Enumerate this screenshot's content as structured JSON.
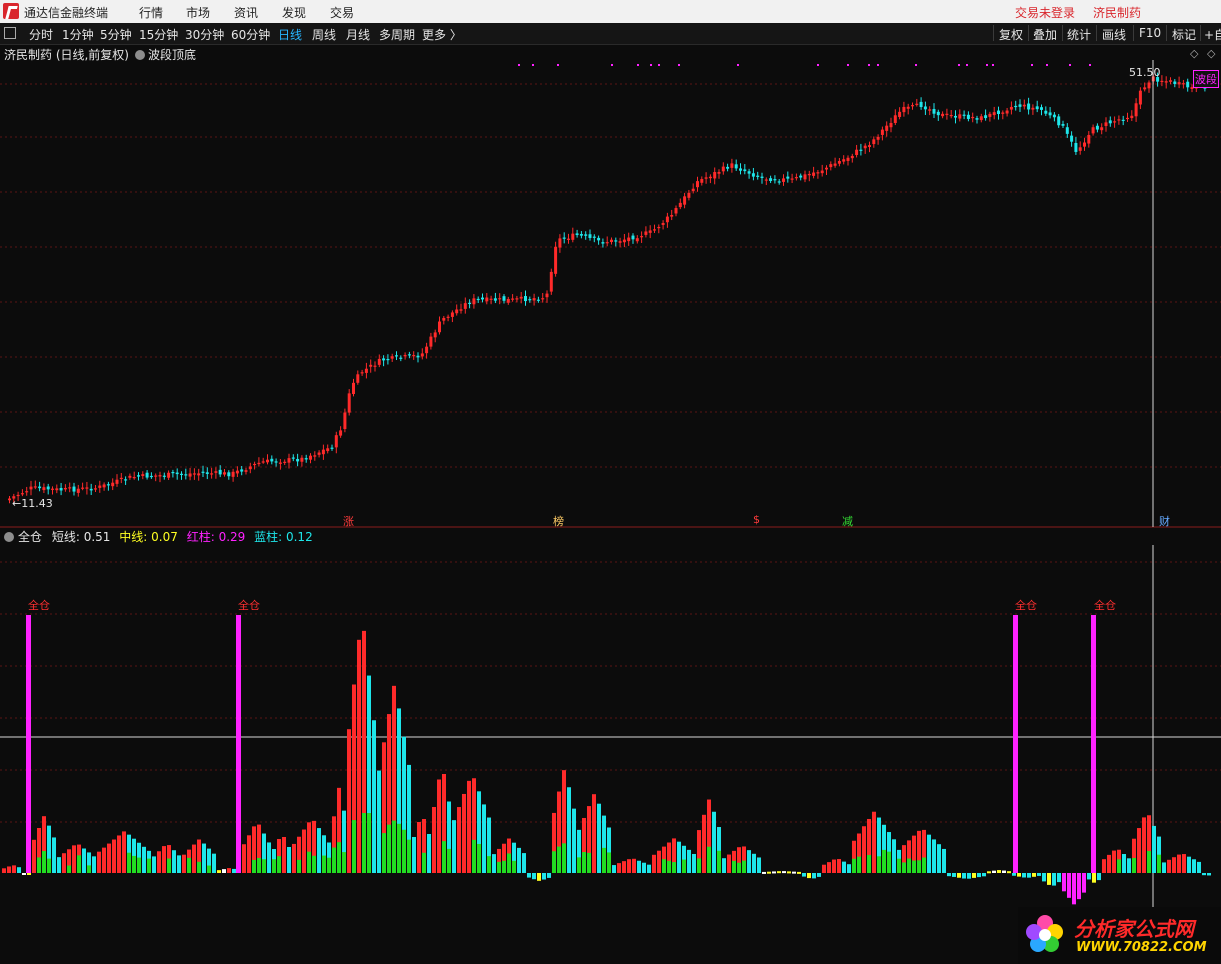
{
  "titlebar": {
    "app_name": "通达信金融终端",
    "menus": [
      "行情",
      "市场",
      "资讯",
      "发现",
      "交易"
    ],
    "login_status": "交易未登录",
    "stock_name": "济民制药"
  },
  "toolbar": {
    "periods": [
      "分时",
      "1分钟",
      "5分钟",
      "15分钟",
      "30分钟",
      "60分钟",
      "日线",
      "周线",
      "月线",
      "多周期",
      "更多 〉"
    ],
    "active_period": "日线",
    "right_buttons": [
      "复权",
      "叠加",
      "统计",
      "画线",
      "F10",
      "标记",
      "+自"
    ]
  },
  "chart": {
    "title": "济民制药 (日线,前复权)",
    "indicator_name": "波段顶底",
    "high_label": "51.50",
    "low_label": "←11.43",
    "right_tag": "波段",
    "event_markers": [
      "涨",
      "榜",
      "$",
      "减",
      "财"
    ]
  },
  "indicator": {
    "name": "全仓",
    "values": [
      {
        "label": "短线:",
        "value": "0.51"
      },
      {
        "label": "中线:",
        "value": "0.07"
      },
      {
        "label": "红柱:",
        "value": "0.29"
      },
      {
        "label": "蓝柱:",
        "value": "0.12"
      }
    ],
    "signal_label": "全仓"
  },
  "colors": {
    "up": "#ff2a2a",
    "down": "#1ee6ea",
    "magenta": "#ff22ff",
    "green": "#22dd22",
    "yellow": "#ffff22"
  },
  "watermark": {
    "title": "分析家公式网",
    "url": "WWW.70822.COM"
  }
}
